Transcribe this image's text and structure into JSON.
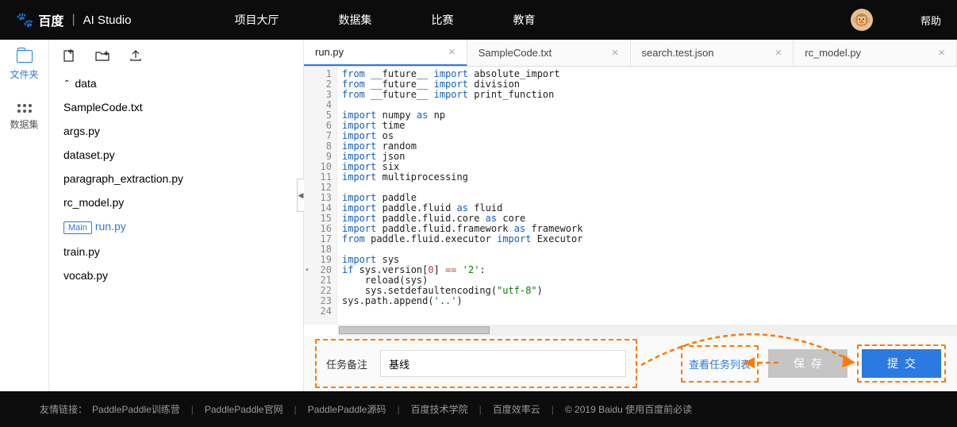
{
  "header": {
    "logo_baidu": "百度",
    "logo_ai": "AI Studio",
    "nav": [
      "项目大厅",
      "数据集",
      "比赛",
      "教育"
    ],
    "help": "帮助"
  },
  "leftbar": {
    "files": "文件夹",
    "dataset": "数据集"
  },
  "filetree": {
    "root": "data",
    "files": [
      "SampleCode.txt",
      "args.py",
      "dataset.py",
      "paragraph_extraction.py",
      "rc_model.py"
    ],
    "main_tag": "Main",
    "main_file": "run.py",
    "files2": [
      "train.py",
      "vocab.py"
    ]
  },
  "tabs": [
    {
      "label": "run.py",
      "active": true
    },
    {
      "label": "SampleCode.txt",
      "active": false
    },
    {
      "label": "search.test.json",
      "active": false
    },
    {
      "label": "rc_model.py",
      "active": false
    }
  ],
  "code_lines": 24,
  "bottom": {
    "task_label": "任务备注",
    "task_value": "基线",
    "view_list": "查看任务列表",
    "save": "保存",
    "submit": "提交"
  },
  "footer": {
    "label": "友情链接：",
    "links": [
      "PaddlePaddle训练营",
      "PaddlePaddle官网",
      "PaddlePaddle源码",
      "百度技术学院",
      "百度效率云"
    ],
    "copy": "© 2019 Baidu 使用百度前必读"
  }
}
